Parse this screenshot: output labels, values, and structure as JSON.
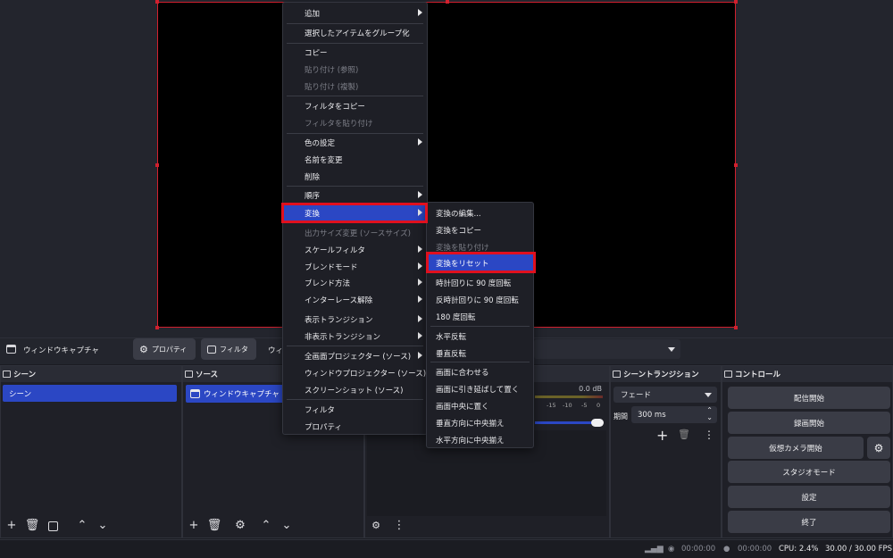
{
  "context_menu": {
    "items": [
      {
        "label": "追加",
        "submenu": true
      },
      {
        "label": "選択したアイテムをグループ化"
      },
      {
        "label": "コピー"
      },
      {
        "label": "貼り付け (参照)",
        "disabled": true
      },
      {
        "label": "貼り付け (複製)",
        "disabled": true
      },
      {
        "label": "フィルタをコピー"
      },
      {
        "label": "フィルタを貼り付け",
        "disabled": true
      },
      {
        "label": "色の設定",
        "submenu": true
      },
      {
        "label": "名前を変更"
      },
      {
        "label": "削除"
      },
      {
        "label": "順序",
        "submenu": true
      },
      {
        "label": "変換",
        "submenu": true,
        "active": true
      },
      {
        "label": "出力サイズ変更 (ソースサイズ)",
        "disabled": true
      },
      {
        "label": "スケールフィルタ",
        "submenu": true
      },
      {
        "label": "ブレンドモード",
        "submenu": true
      },
      {
        "label": "ブレンド方法",
        "submenu": true
      },
      {
        "label": "インターレース解除",
        "submenu": true
      },
      {
        "label": "表示トランジション",
        "submenu": true
      },
      {
        "label": "非表示トランジション",
        "submenu": true
      },
      {
        "label": "全画面プロジェクター (ソース)",
        "submenu": true
      },
      {
        "label": "ウィンドウプロジェクター (ソース)"
      },
      {
        "label": "スクリーンショット (ソース)"
      },
      {
        "label": "フィルタ"
      },
      {
        "label": "プロパティ"
      }
    ]
  },
  "transform_menu": {
    "items": [
      {
        "label": "変換の編集..."
      },
      {
        "label": "変換をコピー"
      },
      {
        "label": "変換を貼り付け",
        "disabled": true
      },
      {
        "label": "変換をリセット",
        "active": true
      },
      {
        "label": "時計回りに 90 度回転"
      },
      {
        "label": "反時計回りに 90 度回転"
      },
      {
        "label": "180 度回転"
      },
      {
        "label": "水平反転"
      },
      {
        "label": "垂直反転"
      },
      {
        "label": "画面に合わせる"
      },
      {
        "label": "画面に引き延ばして置く"
      },
      {
        "label": "画面中央に置く"
      },
      {
        "label": "垂直方向に中央揃え"
      },
      {
        "label": "水平方向に中央揃え"
      }
    ]
  },
  "source_toolbar": {
    "source_name": "ウィンドウキャプチャ",
    "properties_label": "プロパティ",
    "filters_label": "フィルタ",
    "truncated_label": "ウィ"
  },
  "scenes": {
    "title": "シーン",
    "items": [
      "シーン"
    ]
  },
  "sources": {
    "title": "ソース",
    "items": [
      "ウィンドウキャプチャ"
    ]
  },
  "mixer": {
    "level": "0.0 dB",
    "ticks": [
      "-15",
      "-10",
      "-5",
      "0"
    ],
    "volume": 1.0
  },
  "transitions": {
    "title": "シーントランジション",
    "type": "フェード",
    "duration_label": "期間",
    "duration": "300 ms"
  },
  "controls": {
    "title": "コントロール",
    "start_streaming": "配信開始",
    "start_recording": "録画開始",
    "start_virtual_camera": "仮想カメラ開始",
    "studio_mode": "スタジオモード",
    "settings": "設定",
    "exit": "終了"
  },
  "status": {
    "rec_time": "00:00:00",
    "stream_time": "00:00:00",
    "cpu": "CPU: 2.4%",
    "fps": "30.00 / 30.00 FPS"
  },
  "colors": {
    "accent": "#2b47c4",
    "highlight": "#e0101e",
    "bounding_box": "#d1202e"
  }
}
